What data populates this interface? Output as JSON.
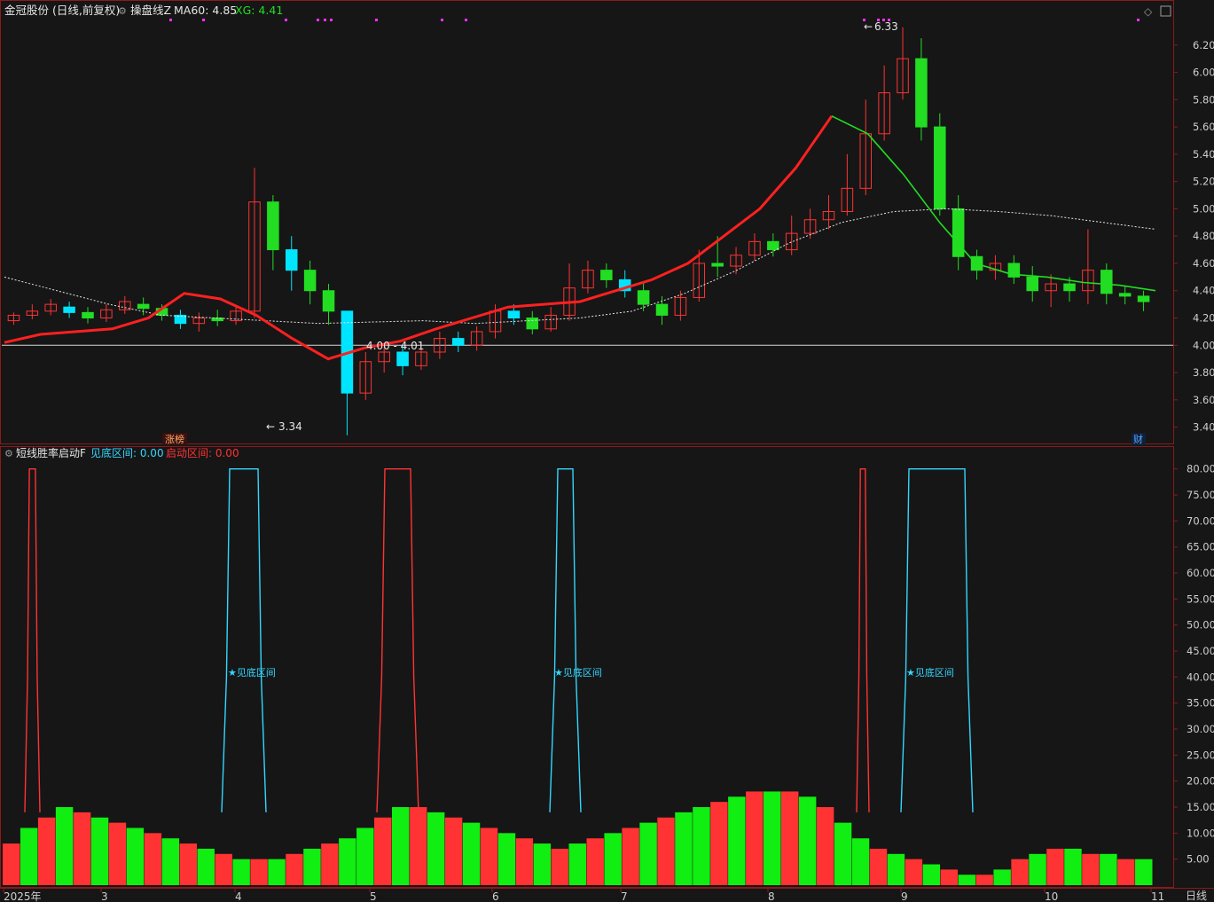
{
  "header": {
    "stock_title": "金冠股份 (日线,前复权)",
    "indicator_name": "操盘线Z",
    "ma60_text": "MA60: 4.85",
    "xg_text": "XG: 4.41"
  },
  "sub_header": {
    "indicator_name": "短线胜率启动F",
    "jiandi_text": "见底区间: 0.00",
    "qidong_text": "启动区间: 0.00"
  },
  "labels": {
    "high": "6.33",
    "low": "3.34",
    "mid": "4.00 - 4.01",
    "zhangbang": "涨榜",
    "cai": "财",
    "star_label": "★见底区间",
    "x_unit": "日线"
  },
  "colors": {
    "up": "#ff3333",
    "down": "#00e5ff",
    "green": "#22dd22",
    "red_line": "#ff2020",
    "cyan": "#33d6ff",
    "magenta": "#ff33ff"
  },
  "chart_data": [
    {
      "type": "candlestick",
      "title": "金冠股份 (日线,前复权)",
      "y_ticks": [
        6.2,
        6.0,
        5.8,
        5.6,
        5.4,
        5.2,
        5.0,
        4.8,
        4.6,
        4.4,
        4.2,
        4.0,
        3.8,
        3.6,
        3.4
      ],
      "ylim": [
        3.3,
        6.4
      ],
      "x_ticks": [
        "2025年",
        "3",
        "4",
        "5",
        "6",
        "7",
        "8",
        "9",
        "10",
        "11"
      ],
      "annotations": {
        "high": 6.33,
        "low": 3.34,
        "range": "4.00 - 4.01"
      },
      "candles_sampled": [
        [
          4.18,
          4.22,
          4.24,
          4.15
        ],
        [
          4.22,
          4.25,
          4.3,
          4.19
        ],
        [
          4.25,
          4.3,
          4.34,
          4.22
        ],
        [
          4.28,
          4.24,
          4.32,
          4.2
        ],
        [
          4.24,
          4.2,
          4.28,
          4.16
        ],
        [
          4.2,
          4.26,
          4.3,
          4.17
        ],
        [
          4.26,
          4.32,
          4.36,
          4.23
        ],
        [
          4.3,
          4.27,
          4.35,
          4.22
        ],
        [
          4.27,
          4.22,
          4.3,
          4.18
        ],
        [
          4.22,
          4.16,
          4.26,
          4.12
        ],
        [
          4.16,
          4.2,
          4.24,
          4.1
        ],
        [
          4.2,
          4.18,
          4.26,
          4.14
        ],
        [
          4.18,
          4.25,
          4.28,
          4.15
        ],
        [
          4.25,
          5.05,
          5.3,
          4.2
        ],
        [
          5.05,
          4.7,
          5.1,
          4.55
        ],
        [
          4.7,
          4.55,
          4.8,
          4.4
        ],
        [
          4.55,
          4.4,
          4.62,
          4.3
        ],
        [
          4.4,
          4.25,
          4.45,
          4.15
        ],
        [
          4.25,
          3.65,
          4.1,
          3.34
        ],
        [
          3.65,
          3.88,
          3.95,
          3.6
        ],
        [
          3.88,
          3.95,
          4.0,
          3.8
        ],
        [
          3.95,
          3.85,
          4.0,
          3.78
        ],
        [
          3.85,
          3.95,
          4.02,
          3.82
        ],
        [
          3.95,
          4.05,
          4.1,
          3.9
        ],
        [
          4.05,
          4.0,
          4.1,
          3.95
        ],
        [
          4.0,
          4.1,
          4.14,
          3.96
        ],
        [
          4.1,
          4.25,
          4.3,
          4.05
        ],
        [
          4.25,
          4.2,
          4.3,
          4.15
        ],
        [
          4.2,
          4.12,
          4.25,
          4.08
        ],
        [
          4.12,
          4.22,
          4.28,
          4.1
        ],
        [
          4.22,
          4.42,
          4.6,
          4.18
        ],
        [
          4.42,
          4.55,
          4.62,
          4.38
        ],
        [
          4.55,
          4.48,
          4.6,
          4.42
        ],
        [
          4.48,
          4.4,
          4.55,
          4.35
        ],
        [
          4.4,
          4.3,
          4.46,
          4.25
        ],
        [
          4.3,
          4.22,
          4.36,
          4.15
        ],
        [
          4.22,
          4.35,
          4.4,
          4.18
        ],
        [
          4.35,
          4.6,
          4.7,
          4.32
        ],
        [
          4.6,
          4.58,
          4.8,
          4.5
        ],
        [
          4.58,
          4.66,
          4.72,
          4.52
        ],
        [
          4.66,
          4.76,
          4.82,
          4.62
        ],
        [
          4.76,
          4.7,
          4.82,
          4.65
        ],
        [
          4.7,
          4.82,
          4.95,
          4.66
        ],
        [
          4.82,
          4.92,
          5.0,
          4.78
        ],
        [
          4.92,
          4.98,
          5.1,
          4.85
        ],
        [
          4.98,
          5.15,
          5.4,
          4.95
        ],
        [
          5.15,
          5.55,
          5.8,
          5.1
        ],
        [
          5.55,
          5.85,
          6.05,
          5.5
        ],
        [
          5.85,
          6.1,
          6.33,
          5.8
        ],
        [
          6.1,
          5.6,
          6.25,
          5.5
        ],
        [
          5.6,
          5.0,
          5.7,
          4.95
        ],
        [
          5.0,
          4.65,
          5.1,
          4.55
        ],
        [
          4.65,
          4.55,
          4.7,
          4.48
        ],
        [
          4.55,
          4.6,
          4.66,
          4.48
        ],
        [
          4.6,
          4.5,
          4.66,
          4.45
        ],
        [
          4.5,
          4.4,
          4.58,
          4.32
        ],
        [
          4.4,
          4.45,
          4.52,
          4.28
        ],
        [
          4.45,
          4.4,
          4.5,
          4.32
        ],
        [
          4.4,
          4.55,
          4.85,
          4.3
        ],
        [
          4.55,
          4.38,
          4.6,
          4.3
        ],
        [
          4.38,
          4.36,
          4.44,
          4.3
        ],
        [
          4.36,
          4.32,
          4.4,
          4.25
        ]
      ],
      "series": [
        {
          "name": "操盘线Z",
          "values": [
            4.02,
            4.08,
            4.1,
            4.12,
            4.2,
            4.38,
            4.34,
            4.22,
            4.05,
            3.9,
            3.98,
            4.03,
            4.12,
            4.2,
            4.28,
            4.3,
            4.32,
            4.4,
            4.48,
            4.6,
            4.8,
            5.0,
            5.3,
            5.68,
            5.55,
            5.25,
            4.9,
            4.6,
            4.52,
            4.5,
            4.46,
            4.44,
            4.4
          ]
        },
        {
          "name": "MA60",
          "values": [
            4.5,
            4.4,
            4.3,
            4.22,
            4.2,
            4.18,
            4.16,
            4.17,
            4.18,
            4.16,
            4.18,
            4.2,
            4.25,
            4.38,
            4.55,
            4.75,
            4.9,
            4.98,
            5.0,
            4.98,
            4.95,
            4.9,
            4.85
          ]
        }
      ]
    },
    {
      "type": "bar",
      "title": "短线胜率启动F",
      "y_ticks": [
        80.0,
        75.0,
        70.0,
        65.0,
        60.0,
        55.0,
        50.0,
        45.0,
        40.0,
        35.0,
        30.0,
        25.0,
        20.0,
        15.0,
        10.0,
        5.0
      ],
      "ylim": [
        0,
        82
      ],
      "series": [
        {
          "name": "见底区间",
          "values": [
            0.0
          ]
        },
        {
          "name": "启动区间",
          "values": [
            0.0
          ]
        }
      ],
      "bar_values_sampled": [
        8,
        11,
        13,
        15,
        14,
        13,
        12,
        11,
        10,
        9,
        8,
        7,
        6,
        5,
        5,
        5,
        6,
        7,
        8,
        9,
        11,
        13,
        15,
        15,
        14,
        13,
        12,
        11,
        10,
        9,
        8,
        7,
        8,
        9,
        10,
        11,
        12,
        13,
        14,
        15,
        16,
        17,
        18,
        18,
        18,
        17,
        15,
        12,
        9,
        7,
        6,
        5,
        4,
        3,
        2,
        2,
        3,
        5,
        6,
        7,
        7,
        6,
        6,
        5,
        5
      ]
    }
  ]
}
